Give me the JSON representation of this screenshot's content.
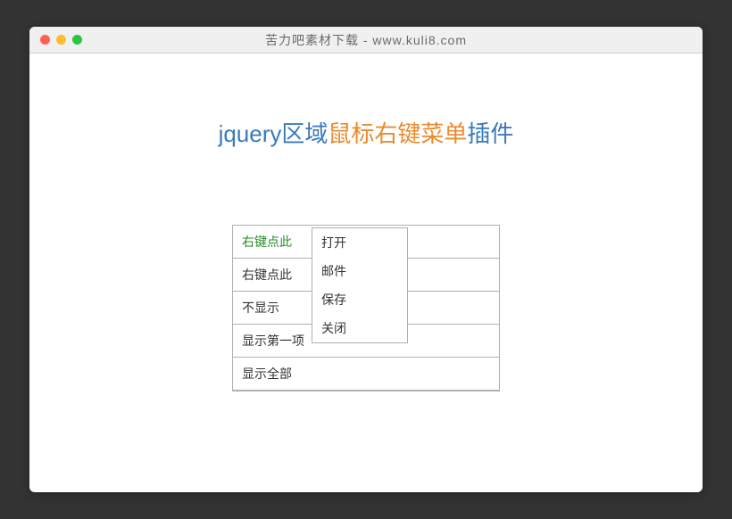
{
  "titlebar": {
    "title": "苦力吧素材下载 - www.kuli8.com"
  },
  "heading": {
    "part1": "jquery区域",
    "highlight": "鼠标右键菜单",
    "part3": "插件"
  },
  "list": {
    "items": [
      {
        "label": "右键点此",
        "active": true
      },
      {
        "label": "右键点此",
        "active": false
      },
      {
        "label": "不显示",
        "active": false
      },
      {
        "label": "显示第一项",
        "active": false
      },
      {
        "label": "显示全部",
        "active": false
      }
    ]
  },
  "context_menu": {
    "items": [
      {
        "label": "打开"
      },
      {
        "label": "邮件"
      },
      {
        "label": "保存"
      },
      {
        "label": "关闭"
      }
    ]
  }
}
